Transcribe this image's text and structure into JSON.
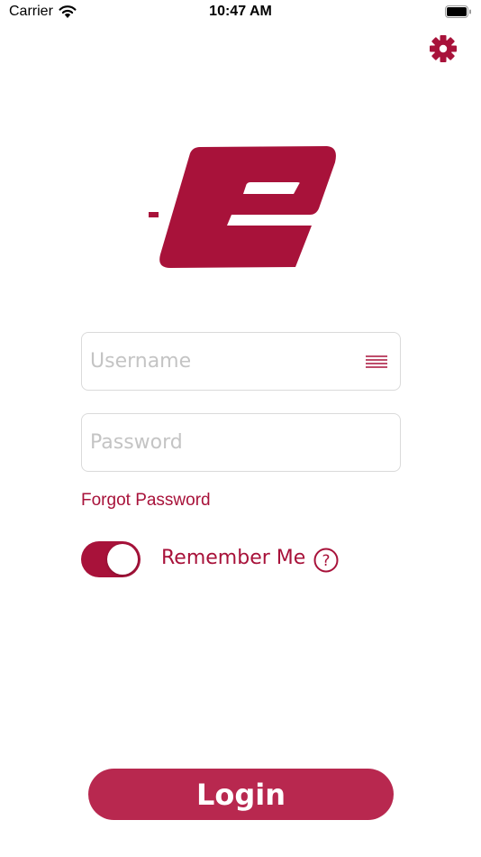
{
  "status_bar": {
    "carrier": "Carrier",
    "time": "10:47 AM"
  },
  "login_form": {
    "username_placeholder": "Username",
    "password_placeholder": "Password",
    "forgot_password": "Forgot Password",
    "remember_me": "Remember Me",
    "remember_me_on": true,
    "help_glyph": "?",
    "login_label": "Login"
  },
  "icons": {
    "settings": "gear-icon",
    "username_menu": "menu-lines-icon",
    "help": "question-circle-icon",
    "logo": "e-logo"
  },
  "colors": {
    "brand": "#a8123a",
    "login_button": "#b8284f",
    "field_border": "#dadada",
    "placeholder": "#c4c4c4"
  }
}
